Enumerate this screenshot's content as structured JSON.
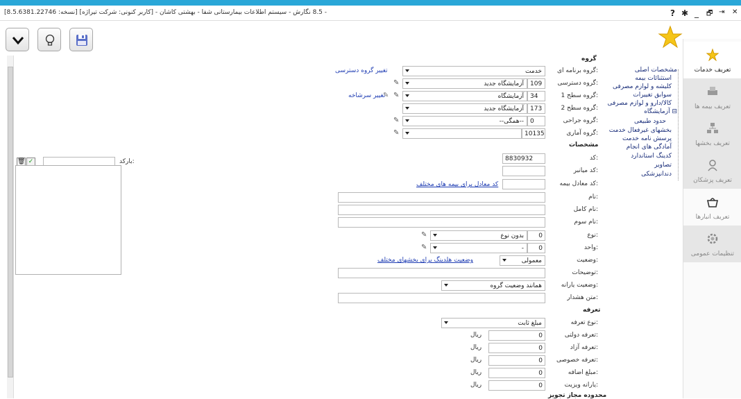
{
  "window": {
    "title": "[8.5.6381.22746 :نسخه] 8.5 نگارش - سیستم اطلاعات بیمارستانی شفا - بهشتی کاشان - [کاربر کنونی: شرکت تیراژه] -",
    "help": "?",
    "gear": "✱",
    "min": "_",
    "restore": "🗗",
    "exit": "⇥",
    "close": "✕"
  },
  "nav": {
    "items": [
      {
        "label": "تعریف خدمات",
        "icon": "star-icon"
      },
      {
        "label": "تعریف بیمه ها",
        "icon": "printer-icon"
      },
      {
        "label": "تعریف بخشها",
        "icon": "org-chart-icon"
      },
      {
        "label": "تعریف پزشکان",
        "icon": "doctor-icon"
      },
      {
        "label": "تعریف انبارها",
        "icon": "basket-icon"
      },
      {
        "label": "تنظیمات عمومی",
        "icon": "settings-icon"
      }
    ]
  },
  "tree": {
    "items": [
      {
        "label": "مشخصات اصلی",
        "level": 0
      },
      {
        "label": "استثنائات بیمه",
        "level": 1
      },
      {
        "label": "کلیشه و لوازم مصرفی",
        "level": 1
      },
      {
        "label": "سوابق تغییرات",
        "level": 1
      },
      {
        "label": "کالا/دارو و لوازم مصرفی",
        "level": 1
      },
      {
        "label": "⊟ آزمایشگاه",
        "level": 0
      },
      {
        "label": "حدود طبیعی",
        "level": 2
      },
      {
        "label": "بخشهای غیرفعال خدمت",
        "level": 1
      },
      {
        "label": "پرسش نامه خدمت",
        "level": 1
      },
      {
        "label": "آمادگی های انجام",
        "level": 1
      },
      {
        "label": "کدینگ استاندارد",
        "level": 1
      },
      {
        "label": "تصاویر",
        "level": 1
      },
      {
        "label": "دندانپزشکی",
        "level": 1
      }
    ]
  },
  "group": {
    "header": "گروه",
    "program_group_label": "گروه برنامه ای:",
    "program_group_value": "خدمت",
    "change_access_group": "تغییر گروه دسترسی",
    "access_group_label": "گروه دسترسی:",
    "access_group_code": "109",
    "access_group_value": "آزمایشگاه جدید",
    "level1_label": "گروه سطح 1:",
    "level1_code": "34",
    "level1_value": "آزمایشگاه",
    "change_header": "تغییر سرشاخه",
    "level2_label": "گروه سطح 2:",
    "level2_code": "173",
    "level2_value": "آزمایشگاه جدید",
    "surgery_label": "گروه جراحی:",
    "surgery_code": "0",
    "surgery_value": "--همگی--",
    "stat_label": "گروه آماری:",
    "stat_code": "10135"
  },
  "specs": {
    "header": "مشخصات",
    "code_label": "کد:",
    "code_value": "8830932",
    "shortcut_label": "کد میانبر:",
    "insurance_eq_label": "کد معادل بیمه:",
    "insurance_eq_link": "کد معادل برای بیمه های مختلف",
    "name_label": "نام:",
    "fullname_label": "نام کامل:",
    "thirdname_label": "نام سوم:",
    "type_label": "نوع:",
    "type_code": "0",
    "type_value": "بدون نوع",
    "unit_label": "واحد:",
    "unit_code": "0",
    "unit_value": "-",
    "status_label": "وضعیت:",
    "status_value": "معمولی",
    "holding_link": "وضعیت هلدینگ برای بخشهای مختلف",
    "desc_label": "توضیحات:",
    "subsidy_label": "وضعیت یارانه:",
    "subsidy_value": "همانند وضعیت گروه",
    "warning_label": "متن هشدار:",
    "barcode_label": "بارکد:"
  },
  "tariff": {
    "header": "تعرفه",
    "type_label": "نوع تعرفه:",
    "type_value": "مبلغ ثابت",
    "rows": [
      {
        "label": "تعرفه دولتی:",
        "value": "0",
        "unit": "ریال"
      },
      {
        "label": "تعرفه آزاد:",
        "value": "0",
        "unit": "ریال"
      },
      {
        "label": "تعرفه خصوصی:",
        "value": "0",
        "unit": "ریال"
      },
      {
        "label": "مبلغ اضافه:",
        "value": "0",
        "unit": "ریال"
      },
      {
        "label": "یارانه ویزیت:",
        "value": "0",
        "unit": "ریال"
      }
    ],
    "next_header": "محدوده مجاز تجویز"
  }
}
